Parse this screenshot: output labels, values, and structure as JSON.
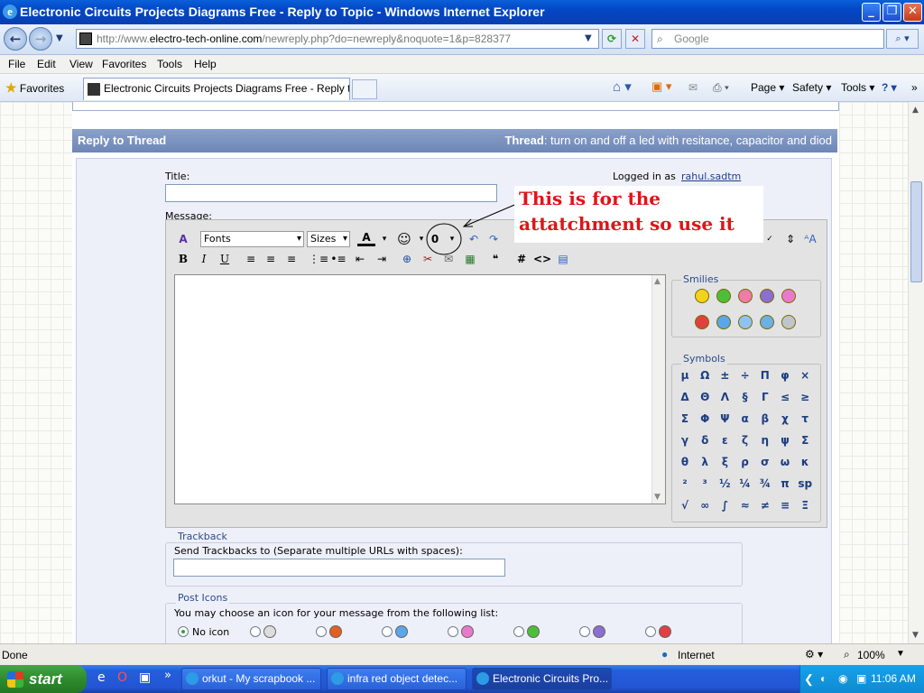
{
  "window": {
    "title": "Electronic Circuits Projects Diagrams Free - Reply to Topic - Windows Internet Explorer",
    "min": "_",
    "max": "❐",
    "close": "✕"
  },
  "address": {
    "url_prefix": "http://www.",
    "url_domain": "electro-tech-online.com",
    "url_path": "/newreply.php?do=newreply&noquote=1&p=828377",
    "search_placeholder": "Google"
  },
  "menu": [
    "File",
    "Edit",
    "View",
    "Favorites",
    "Tools",
    "Help"
  ],
  "favbar": {
    "favorites": "Favorites",
    "tab_title": "Electronic Circuits Projects Diagrams Free - Reply to T...",
    "page": "Page ▾",
    "safety": "Safety ▾",
    "tools": "Tools ▾",
    "help": "? ▾"
  },
  "thread": {
    "header": "Reply to Thread",
    "thread_label": "Thread",
    "thread_title": ": turn on and off a led with resitance, capacitor and diod"
  },
  "form": {
    "title_label": "Title:",
    "logged_in": "Logged in as",
    "username": "rahul.sadtm",
    "message_label": "Message:",
    "fonts": "Fonts",
    "sizes": "Sizes"
  },
  "annotation": {
    "line1": "This is for the",
    "line2": "attatchment so use it"
  },
  "smilies": {
    "legend": "Smilies",
    "count": 10
  },
  "symbols": {
    "legend": "Symbols",
    "rows": [
      [
        "μ",
        "Ω",
        "±",
        "÷",
        "Π",
        "φ",
        "×"
      ],
      [
        "Δ",
        "Θ",
        "Λ",
        "§",
        "Γ",
        "≤",
        "≥"
      ],
      [
        "Σ",
        "Φ",
        "Ψ",
        "α",
        "β",
        "χ",
        "τ"
      ],
      [
        "γ",
        "δ",
        "ε",
        "ζ",
        "η",
        "ψ",
        "Σ"
      ],
      [
        "θ",
        "λ",
        "ξ",
        "ρ",
        "σ",
        "ω",
        "κ"
      ],
      [
        "²",
        "³",
        "½",
        "¼",
        "¾",
        "π",
        "sp"
      ],
      [
        "√",
        "∞",
        "∫",
        "≈",
        "≠",
        "≡",
        "Ξ"
      ]
    ]
  },
  "trackback": {
    "legend": "Trackback",
    "label": "Send Trackbacks to (Separate multiple URLs with spaces):"
  },
  "post_icons": {
    "legend": "Post Icons",
    "label": "You may choose an icon for your message from the following list:",
    "no_icon": "No icon"
  },
  "status": {
    "text": "Done",
    "zone": "Internet",
    "zoom": "100%"
  },
  "taskbar": {
    "start": "start",
    "tasks": [
      "orkut - My scrapbook ...",
      "infra red object detec...",
      "Electronic Circuits Pro..."
    ],
    "clock": "11:06 AM"
  },
  "colors": {
    "header_bg": "#7a92bf",
    "annotation_text": "#e0141a",
    "symbol_text": "#1c3e82"
  }
}
